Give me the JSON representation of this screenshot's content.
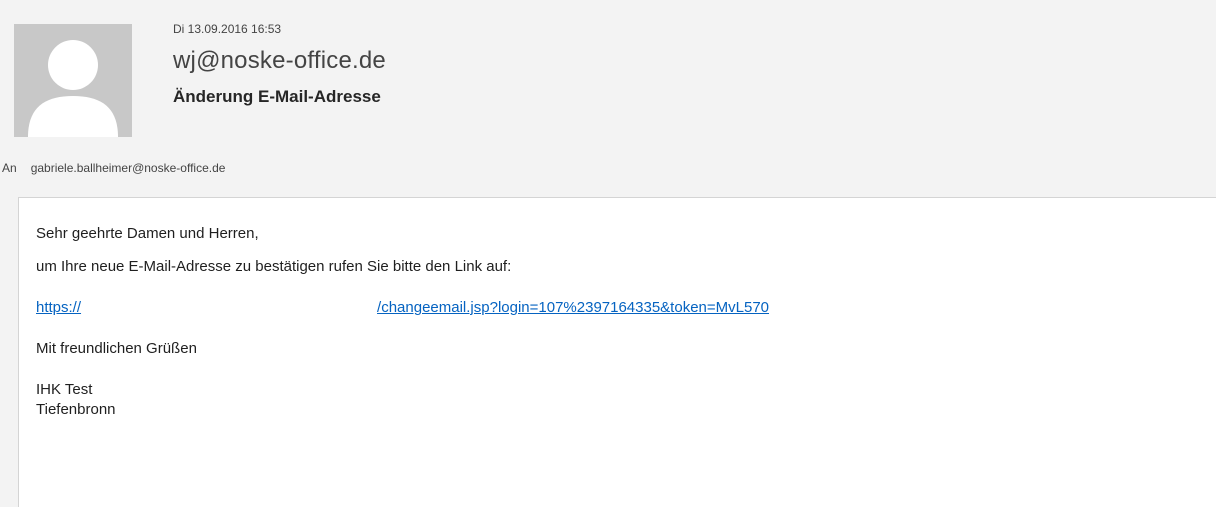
{
  "header": {
    "sent_date": "Di 13.09.2016 16:53",
    "sender": "wj@noske-office.de",
    "subject": "Änderung E-Mail-Adresse"
  },
  "recipients": {
    "label": "An",
    "to": "gabriele.ballheimer@noske-office.de"
  },
  "body": {
    "greeting": "Sehr geehrte Damen und Herren,",
    "instruction": "um Ihre neue E-Mail-Adresse zu bestätigen rufen Sie bitte den Link auf:",
    "link_start": "https://",
    "link_end": "/changeemail.jsp?login=107%2397164335&token=MvL570",
    "closing": "Mit freundlichen Grüßen",
    "signature_line1": "IHK Test",
    "signature_line2": "Tiefenbronn"
  },
  "colors": {
    "link": "#0563c1",
    "avatar_bg": "#c8c8c8",
    "avatar_figure": "#ffffff"
  },
  "icons": {
    "avatar": "person-silhouette-icon"
  }
}
